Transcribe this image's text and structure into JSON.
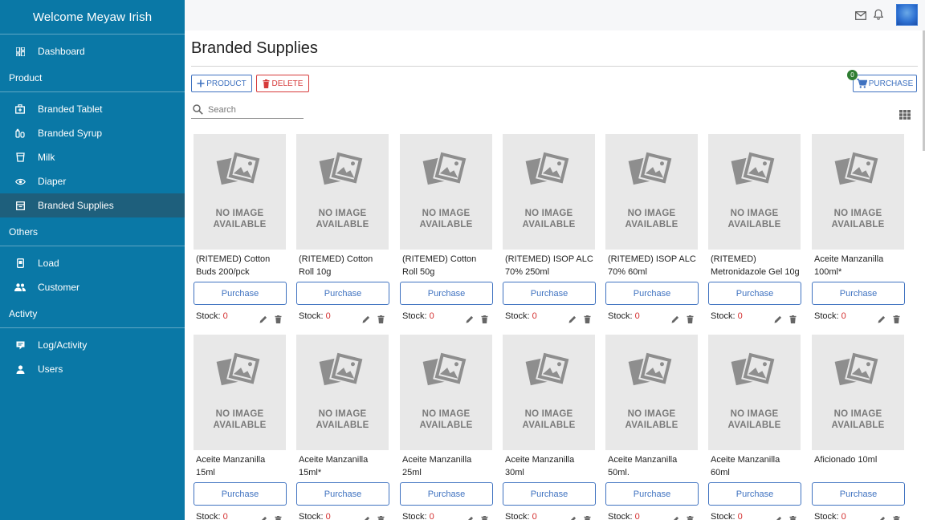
{
  "app": {
    "welcome": "Welcome  Meyaw Irish"
  },
  "sidebar": {
    "dashboard": {
      "label": "Dashboard",
      "icon": "dashboard-icon"
    },
    "sections": [
      {
        "title": "Product",
        "items": [
          {
            "label": "Branded Tablet",
            "icon": "medical-bag-icon",
            "active": false
          },
          {
            "label": "Branded Syrup",
            "icon": "syrup-icon",
            "active": false
          },
          {
            "label": "Milk",
            "icon": "milk-icon",
            "active": false
          },
          {
            "label": "Diaper",
            "icon": "eye-icon",
            "active": false
          },
          {
            "label": "Branded Supplies",
            "icon": "archive-icon",
            "active": true
          }
        ]
      },
      {
        "title": "Others",
        "items": [
          {
            "label": "Load",
            "icon": "phone-icon",
            "active": false
          },
          {
            "label": "Customer",
            "icon": "people-icon",
            "active": false
          }
        ]
      },
      {
        "title": "Activty",
        "items": [
          {
            "label": "Log/Activity",
            "icon": "log-icon",
            "active": false
          },
          {
            "label": "Users",
            "icon": "user-icon",
            "active": false
          }
        ]
      }
    ]
  },
  "header": {
    "mail_icon": "mail-icon",
    "bell_icon": "bell-icon"
  },
  "page": {
    "title": "Branded Supplies",
    "add_product_label": "PRODUCT",
    "delete_label": "DELETE",
    "purchase_label": "PURCHASE",
    "cart_count": "0",
    "search_placeholder": "Search"
  },
  "card_common": {
    "no_image_line1": "NO IMAGE",
    "no_image_line2": "AVAILABLE",
    "purchase_label": "Purchase",
    "stock_label": "Stock:"
  },
  "products": [
    {
      "name": "(RITEMED) Cotton Buds 200/pck",
      "stock": "0"
    },
    {
      "name": "(RITEMED) Cotton Roll 10g",
      "stock": "0"
    },
    {
      "name": "(RITEMED) Cotton Roll 50g",
      "stock": "0"
    },
    {
      "name": "(RITEMED) ISOP ALC 70% 250ml",
      "stock": "0"
    },
    {
      "name": "(RITEMED) ISOP ALC 70% 60ml",
      "stock": "0"
    },
    {
      "name": "(RITEMED) Metronidazole Gel 10g",
      "stock": "0"
    },
    {
      "name": "Aceite Manzanilla 100ml*",
      "stock": "0"
    },
    {
      "name": "Aceite Manzanilla 15ml",
      "stock": "0"
    },
    {
      "name": "Aceite Manzanilla 15ml*",
      "stock": "0"
    },
    {
      "name": "Aceite Manzanilla 25ml",
      "stock": "0"
    },
    {
      "name": "Aceite Manzanilla 30ml",
      "stock": "0"
    },
    {
      "name": "Aceite Manzanilla 50ml.",
      "stock": "0"
    },
    {
      "name": "Aceite Manzanilla 60ml",
      "stock": "0"
    },
    {
      "name": "Aficionado 10ml",
      "stock": "0"
    }
  ],
  "colors": {
    "sidebar": "#0a78a6",
    "active_item": "#1e5f7c",
    "accent": "#3f72c0",
    "danger": "#d63a3a"
  }
}
